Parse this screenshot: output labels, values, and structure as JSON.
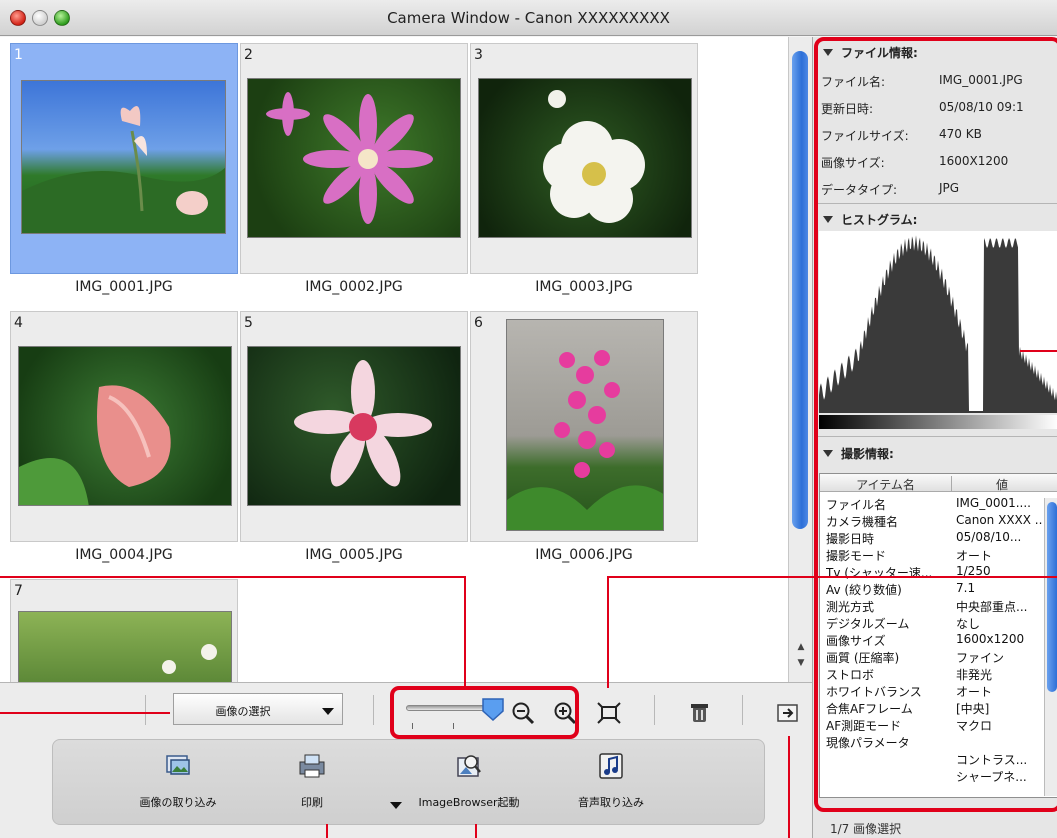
{
  "window": {
    "title": "Camera Window - Canon XXXXXXXXX"
  },
  "thumbnails": [
    {
      "number": "1",
      "filename": "IMG_0001.JPG",
      "selected": true
    },
    {
      "number": "2",
      "filename": "IMG_0002.JPG",
      "selected": false
    },
    {
      "number": "3",
      "filename": "IMG_0003.JPG",
      "selected": false
    },
    {
      "number": "4",
      "filename": "IMG_0004.JPG",
      "selected": false
    },
    {
      "number": "5",
      "filename": "IMG_0005.JPG",
      "selected": false
    },
    {
      "number": "6",
      "filename": "IMG_0006.JPG",
      "selected": false
    },
    {
      "number": "7",
      "filename": "",
      "selected": false
    }
  ],
  "toolbar": {
    "select_dropdown": "画像の選択",
    "zoom_level": 0.85
  },
  "launcher": {
    "import": "画像の取り込み",
    "print": "印刷",
    "imagebrowser": "ImageBrowser起動",
    "sound": "音声取り込み"
  },
  "file_info": {
    "header": "ファイル情報:",
    "rows": [
      {
        "key": "ファイル名:",
        "value": "IMG_0001.JPG"
      },
      {
        "key": "更新日時:",
        "value": "05/08/10 09:1"
      },
      {
        "key": "ファイルサイズ:",
        "value": "470 KB"
      },
      {
        "key": "画像サイズ:",
        "value": "1600X1200"
      },
      {
        "key": "データタイプ:",
        "value": "JPG"
      }
    ]
  },
  "histogram": {
    "header": "ヒストグラム:"
  },
  "shooting_info": {
    "header": "撮影情報:",
    "col_item": "アイテム名",
    "col_value": "値",
    "rows": [
      {
        "item": "ファイル名",
        "value": "IMG_0001...."
      },
      {
        "item": "カメラ機種名",
        "value": "Canon XXXX ..."
      },
      {
        "item": "撮影日時",
        "value": "05/08/10..."
      },
      {
        "item": "撮影モード",
        "value": "オート"
      },
      {
        "item": "Tv (シャッター速...",
        "value": "1/250"
      },
      {
        "item": "Av (絞り数値)",
        "value": "7.1"
      },
      {
        "item": "測光方式",
        "value": "中央部重点..."
      },
      {
        "item": "デジタルズーム",
        "value": "なし"
      },
      {
        "item": "画像サイズ",
        "value": "1600x1200"
      },
      {
        "item": "画質 (圧縮率)",
        "value": "ファイン"
      },
      {
        "item": "ストロボ",
        "value": "非発光"
      },
      {
        "item": "ホワイトバランス",
        "value": "オート"
      },
      {
        "item": "合焦AFフレーム",
        "value": "[中央]"
      },
      {
        "item": "AF測距モード",
        "value": "マクロ"
      },
      {
        "item": "現像パラメータ",
        "value": ""
      },
      {
        "item": "",
        "value": "コントラス..."
      },
      {
        "item": "",
        "value": "シャープネ..."
      }
    ]
  },
  "status": {
    "text": "1/7 画像選択"
  },
  "colors": {
    "callout": "#e0001a",
    "selection": "#8db3f5",
    "scroll_thumb": "#2c6fd7"
  }
}
